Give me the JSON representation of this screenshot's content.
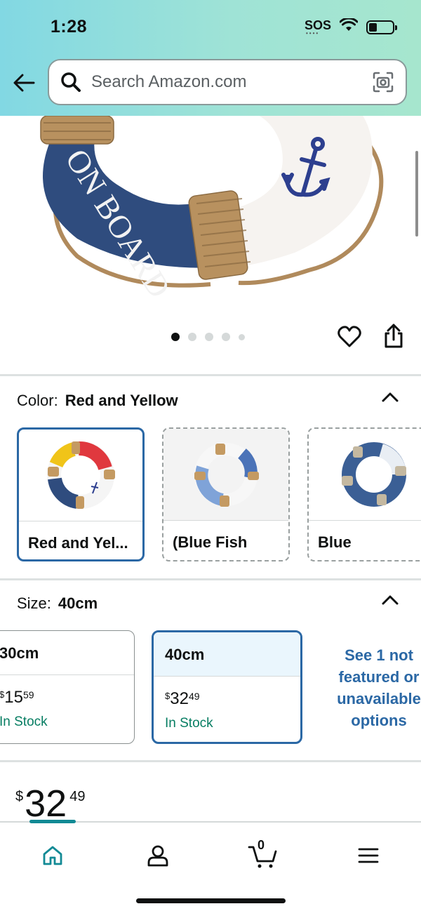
{
  "status_bar": {
    "time": "1:28",
    "sos": "SOS",
    "icons": [
      "wifi-icon",
      "battery-icon"
    ]
  },
  "header": {
    "back_icon": "back-arrow-icon",
    "search_placeholder": "Search Amazon.com",
    "search_icon": "search-icon",
    "camera_icon": "camera-scan-icon"
  },
  "hero": {
    "image_text": "ON BOARD",
    "carousel_total": 5,
    "carousel_active": 1,
    "favorite_icon": "heart-icon",
    "share_icon": "share-icon"
  },
  "color": {
    "label": "Color:",
    "selected": "Red and Yellow",
    "options": [
      {
        "label": "Red and Yel...",
        "selected": true
      },
      {
        "label": "(Blue Fish",
        "selected": false
      },
      {
        "label": "Blue",
        "selected": false
      }
    ]
  },
  "size": {
    "label": "Size:",
    "selected": "40cm",
    "options": [
      {
        "label": "30cm",
        "price_whole": "15",
        "price_frac": "59",
        "currency": "$",
        "stock": "In Stock",
        "selected": false
      },
      {
        "label": "40cm",
        "price_whole": "32",
        "price_frac": "49",
        "currency": "$",
        "stock": "In Stock",
        "selected": true
      }
    ],
    "see_more": "See 1 not featured or unavailable options"
  },
  "price": {
    "currency": "$",
    "whole": "32",
    "fraction": "49"
  },
  "bottom_nav": {
    "items": [
      "home-icon",
      "account-icon",
      "cart-icon",
      "menu-icon"
    ],
    "cart_count": "0",
    "active": "home"
  },
  "colors": {
    "header_gradient_start": "#82d8e3",
    "header_gradient_end": "#a6e6ce",
    "selected_border": "#2b68a5",
    "stock_green": "#067d62",
    "link_blue": "#2b68a5",
    "nav_active": "#128a95"
  }
}
